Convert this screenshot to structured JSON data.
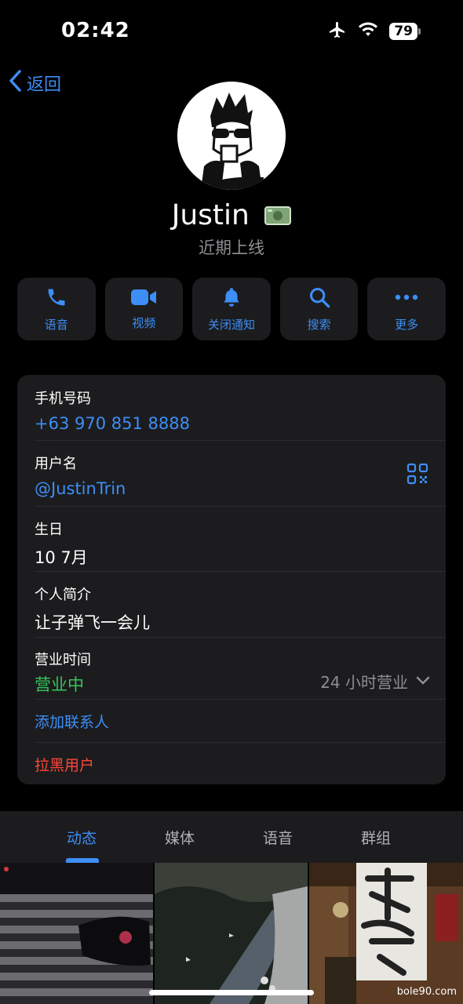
{
  "status_bar": {
    "time": "02:42",
    "battery": "79"
  },
  "nav": {
    "back_label": "返回"
  },
  "profile": {
    "name": "Justin",
    "status": "近期上线"
  },
  "actions": [
    {
      "label": "语音",
      "icon": "phone-icon"
    },
    {
      "label": "视频",
      "icon": "video-icon"
    },
    {
      "label": "关闭通知",
      "icon": "bell-icon"
    },
    {
      "label": "搜索",
      "icon": "search-icon"
    },
    {
      "label": "更多",
      "icon": "more-icon"
    }
  ],
  "info": {
    "phone_label": "手机号码",
    "phone_value": "+63 970 851 8888",
    "username_label": "用户名",
    "username_value": "@JustinTrin",
    "birthday_label": "生日",
    "birthday_value": "10 7月",
    "bio_label": "个人简介",
    "bio_value": "让子弹飞一会儿",
    "hours_label": "营业时间",
    "hours_status": "营业中",
    "hours_detail": "24 小时营业",
    "add_contact": "添加联系人",
    "block_user": "拉黑用户"
  },
  "tabs": [
    "动态",
    "媒体",
    "语音",
    "群组"
  ],
  "active_tab": "动态",
  "watermark": "bole90.com",
  "colors": {
    "accent": "#3d8ef5",
    "green": "#34c759",
    "red": "#ff453a",
    "card": "#1c1c1e"
  }
}
